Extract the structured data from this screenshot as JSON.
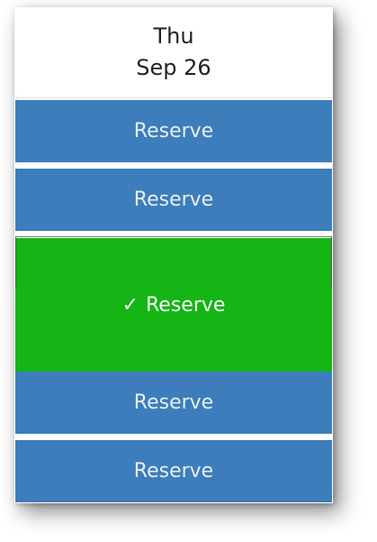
{
  "day": {
    "weekday": "Thu",
    "date": "Sep 26"
  },
  "slots": [
    {
      "label": "Reserve",
      "selected": false
    },
    {
      "label": "Reserve",
      "selected": false
    },
    {
      "label": "Reserve",
      "selected": true,
      "check": "✓"
    },
    {
      "label": "Reserve",
      "selected": false
    },
    {
      "label": "Reserve",
      "selected": false
    }
  ],
  "colors": {
    "slot": "#3d7dbb",
    "selected": "#14b514",
    "header_bg": "#ffffff"
  }
}
